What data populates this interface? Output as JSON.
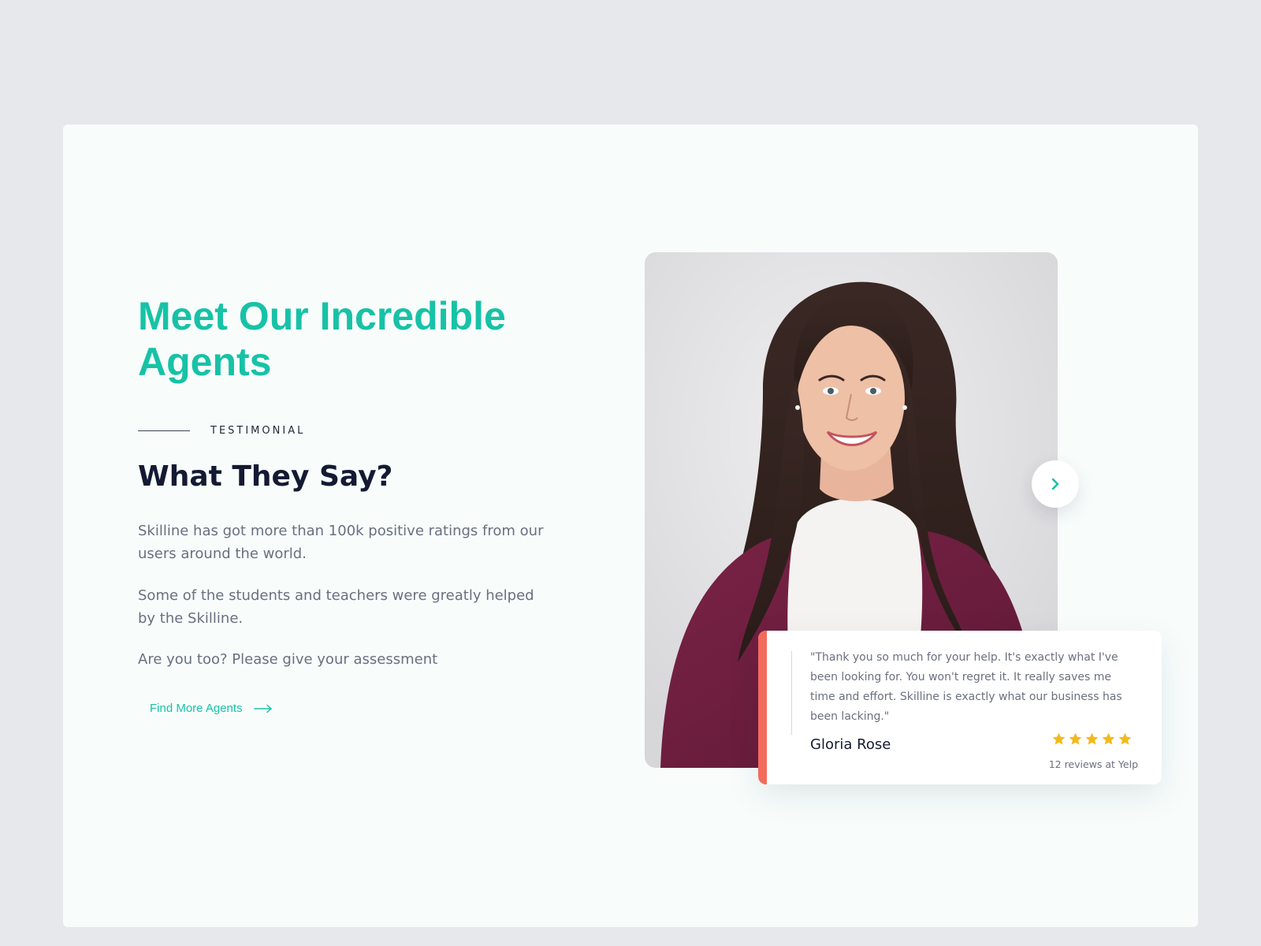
{
  "section": {
    "headline": "Meet Our Incredible Agents",
    "eyebrow": "TESTIMONIAL",
    "subhead": "What They Say?",
    "paragraphs": [
      "Skilline has got more than 100k positive ratings from our users around the world.",
      "Some of the students and teachers were greatly helped by the Skilline.",
      "Are you too? Please give your assessment"
    ],
    "cta": {
      "label": "Find More Agents",
      "icon": "arrow-right-icon"
    }
  },
  "testimonial": {
    "photo": "agent-portrait-photo",
    "quote": "\"Thank you so much for your help. It's exactly what I've been looking for. You won't regret it. It really saves me time and effort. Skilline is exactly what our business has been lacking.\"",
    "author": "Gloria Rose",
    "rating": 5,
    "rating_max": 5,
    "reviews": "12 reviews at Yelp",
    "next_icon": "chevron-right-icon"
  },
  "colors": {
    "page_bg": "#e7e8eb",
    "card_bg": "#f8fdfc",
    "brand_teal": "#17c2a6",
    "accent_coral": "#f26b5b",
    "star_gold": "#f4b91a",
    "heading_dark": "#141a33",
    "body_gray": "#6a6f80"
  }
}
